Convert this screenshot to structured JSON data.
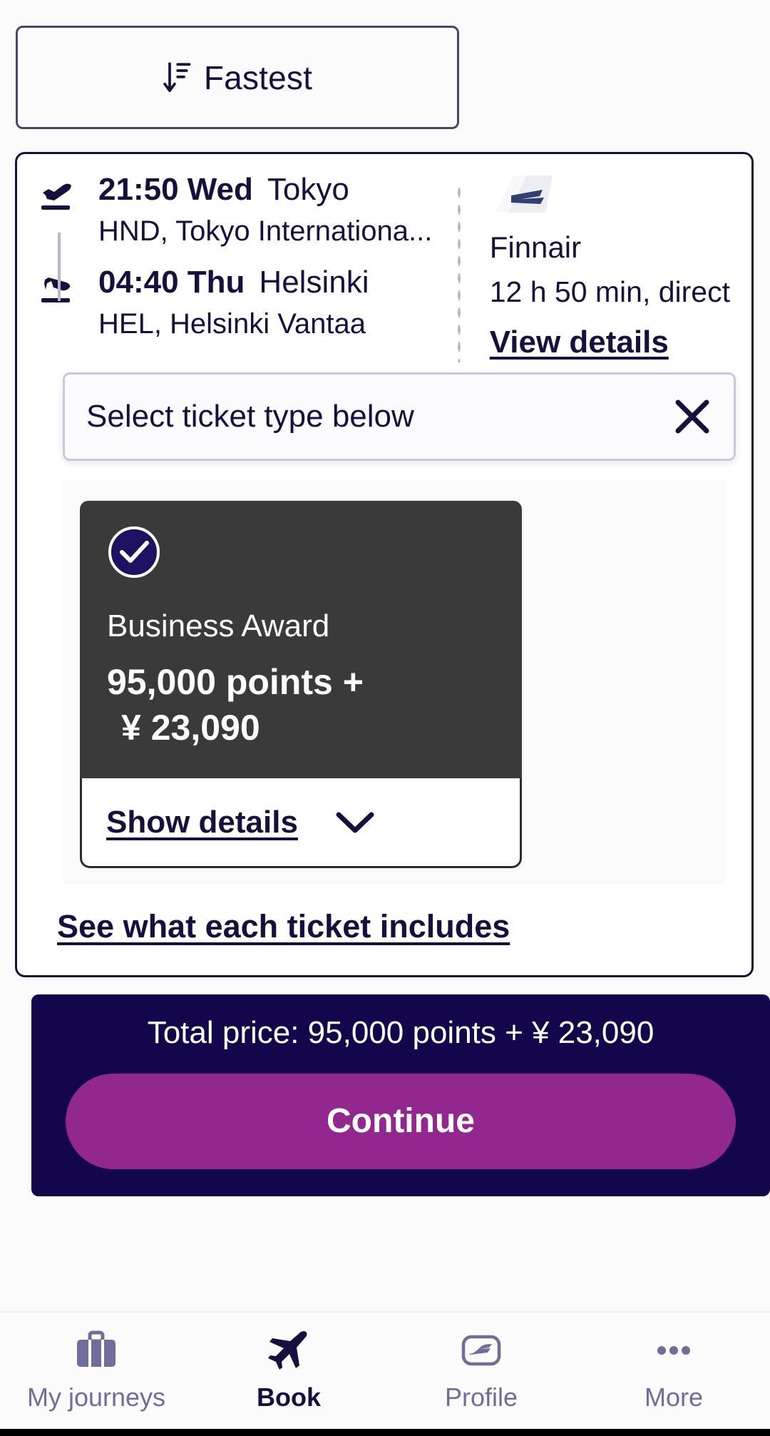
{
  "sort": {
    "label": "Fastest",
    "icon": "sort-descending-icon"
  },
  "flight": {
    "departure": {
      "time": "21:50",
      "day": "Wed",
      "city": "Tokyo",
      "airport": "HND, Tokyo Internationa...",
      "icon": "takeoff-icon"
    },
    "arrival": {
      "time": "04:40",
      "day": "Thu",
      "city": "Helsinki",
      "airport": "HEL, Helsinki Vantaa",
      "icon": "landing-icon"
    },
    "carrier": {
      "logo": "finnair-tail-icon",
      "name": "Finnair",
      "duration": "12 h 50 min, direct",
      "details_link": "View details"
    }
  },
  "banner": {
    "text": "Select ticket type below",
    "close_icon": "close-icon"
  },
  "tickets": [
    {
      "selected": true,
      "select_icon": "check-circle-icon",
      "name": "Business Award",
      "points_line": "95,000 points +",
      "cash_line": "¥ 23,090",
      "show_details_label": "Show details",
      "chevron_icon": "chevron-down-icon"
    }
  ],
  "includes_link": "See what each ticket includes",
  "footer": {
    "total_price": "Total price: 95,000 points +  ¥ 23,090",
    "continue_label": "Continue"
  },
  "bottom_nav": {
    "items": [
      {
        "label": "My journeys",
        "icon": "suitcase-icon",
        "active": false
      },
      {
        "label": "Book",
        "icon": "airplane-icon",
        "active": true
      },
      {
        "label": "Profile",
        "icon": "finnair-card-icon",
        "active": false
      },
      {
        "label": "More",
        "icon": "ellipsis-icon",
        "active": false
      }
    ]
  },
  "colors": {
    "brand_navy": "#17103f",
    "deep_navy_bar": "#14064a",
    "accent_purple": "#92278f",
    "card_dark": "#3a3a3a",
    "muted": "#6f6e9b",
    "page_bg": "#fafafa"
  }
}
